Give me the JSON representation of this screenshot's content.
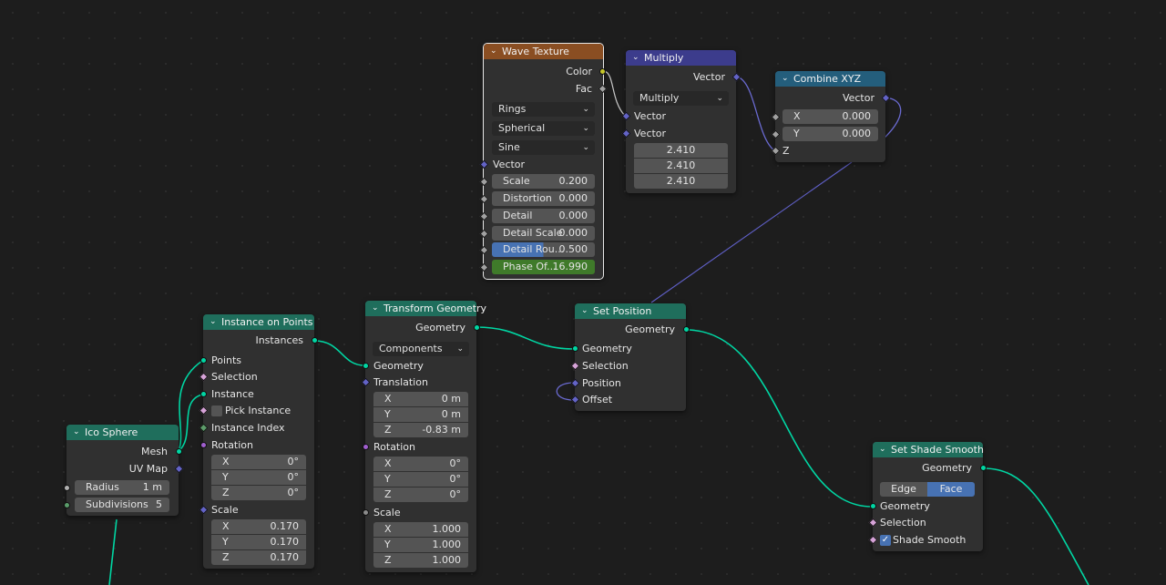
{
  "nodes": {
    "wave_texture": {
      "title": "Wave Texture",
      "outputs": {
        "color": "Color",
        "fac": "Fac"
      },
      "dropdowns": {
        "type": "Rings",
        "profile": "Spherical",
        "wave": "Sine"
      },
      "vector_label": "Vector",
      "fields": [
        {
          "label": "Scale",
          "value": "0.200"
        },
        {
          "label": "Distortion",
          "value": "0.000"
        },
        {
          "label": "Detail",
          "value": "0.000"
        },
        {
          "label": "Detail Scale",
          "value": "0.000"
        },
        {
          "label": "Detail Rou...",
          "value": "0.500"
        },
        {
          "label": "Phase Of...",
          "value": "16.990"
        }
      ]
    },
    "multiply": {
      "title": "Multiply",
      "output": "Vector",
      "operation": "Multiply",
      "inputs": [
        "Vector",
        "Vector"
      ],
      "values": [
        "2.410",
        "2.410",
        "2.410"
      ]
    },
    "combine_xyz": {
      "title": "Combine XYZ",
      "output": "Vector",
      "x": {
        "label": "X",
        "value": "0.000"
      },
      "y": {
        "label": "Y",
        "value": "0.000"
      },
      "z_label": "Z"
    },
    "instance_on_points": {
      "title": "Instance on Points",
      "output": "Instances",
      "inputs": {
        "points": "Points",
        "selection": "Selection",
        "instance": "Instance",
        "pick_instance": "Pick Instance",
        "instance_index": "Instance Index",
        "rotation": "Rotation",
        "scale": "Scale"
      },
      "rotation": [
        {
          "label": "X",
          "value": "0°"
        },
        {
          "label": "Y",
          "value": "0°"
        },
        {
          "label": "Z",
          "value": "0°"
        }
      ],
      "scale": [
        {
          "label": "X",
          "value": "0.170"
        },
        {
          "label": "Y",
          "value": "0.170"
        },
        {
          "label": "Z",
          "value": "0.170"
        }
      ]
    },
    "transform_geometry": {
      "title": "Transform Geometry",
      "output": "Geometry",
      "mode": "Components",
      "inputs": {
        "geometry": "Geometry",
        "translation": "Translation",
        "rotation": "Rotation",
        "scale": "Scale"
      },
      "translation": [
        {
          "label": "X",
          "value": "0 m"
        },
        {
          "label": "Y",
          "value": "0 m"
        },
        {
          "label": "Z",
          "value": "-0.83 m"
        }
      ],
      "rotation": [
        {
          "label": "X",
          "value": "0°"
        },
        {
          "label": "Y",
          "value": "0°"
        },
        {
          "label": "Z",
          "value": "0°"
        }
      ],
      "scale": [
        {
          "label": "X",
          "value": "1.000"
        },
        {
          "label": "Y",
          "value": "1.000"
        },
        {
          "label": "Z",
          "value": "1.000"
        }
      ]
    },
    "set_position": {
      "title": "Set Position",
      "output": "Geometry",
      "inputs": {
        "geometry": "Geometry",
        "selection": "Selection",
        "position": "Position",
        "offset": "Offset"
      }
    },
    "ico_sphere": {
      "title": "Ico Sphere",
      "outputs": {
        "mesh": "Mesh",
        "uv_map": "UV Map"
      },
      "radius": {
        "label": "Radius",
        "value": "1 m"
      },
      "subdivisions": {
        "label": "Subdivisions",
        "value": "5"
      }
    },
    "set_shade_smooth": {
      "title": "Set Shade Smooth",
      "output": "Geometry",
      "domain_options": [
        "Edge",
        "Face"
      ],
      "selected_domain": "Face",
      "inputs": {
        "geometry": "Geometry",
        "selection": "Selection",
        "shade_smooth": "Shade Smooth"
      },
      "shade_smooth_checked": true
    }
  },
  "colors": {
    "geometry_socket": "#00d6a3",
    "vector_socket": "#6b6bd9",
    "geometry_header": "#1f6e5c",
    "texture_header": "#8a4e22",
    "vector_header": "#3c3c8c",
    "combine_header": "#245e7c",
    "link_geometry": "#00d6a3",
    "link_vector": "#6060c8"
  }
}
